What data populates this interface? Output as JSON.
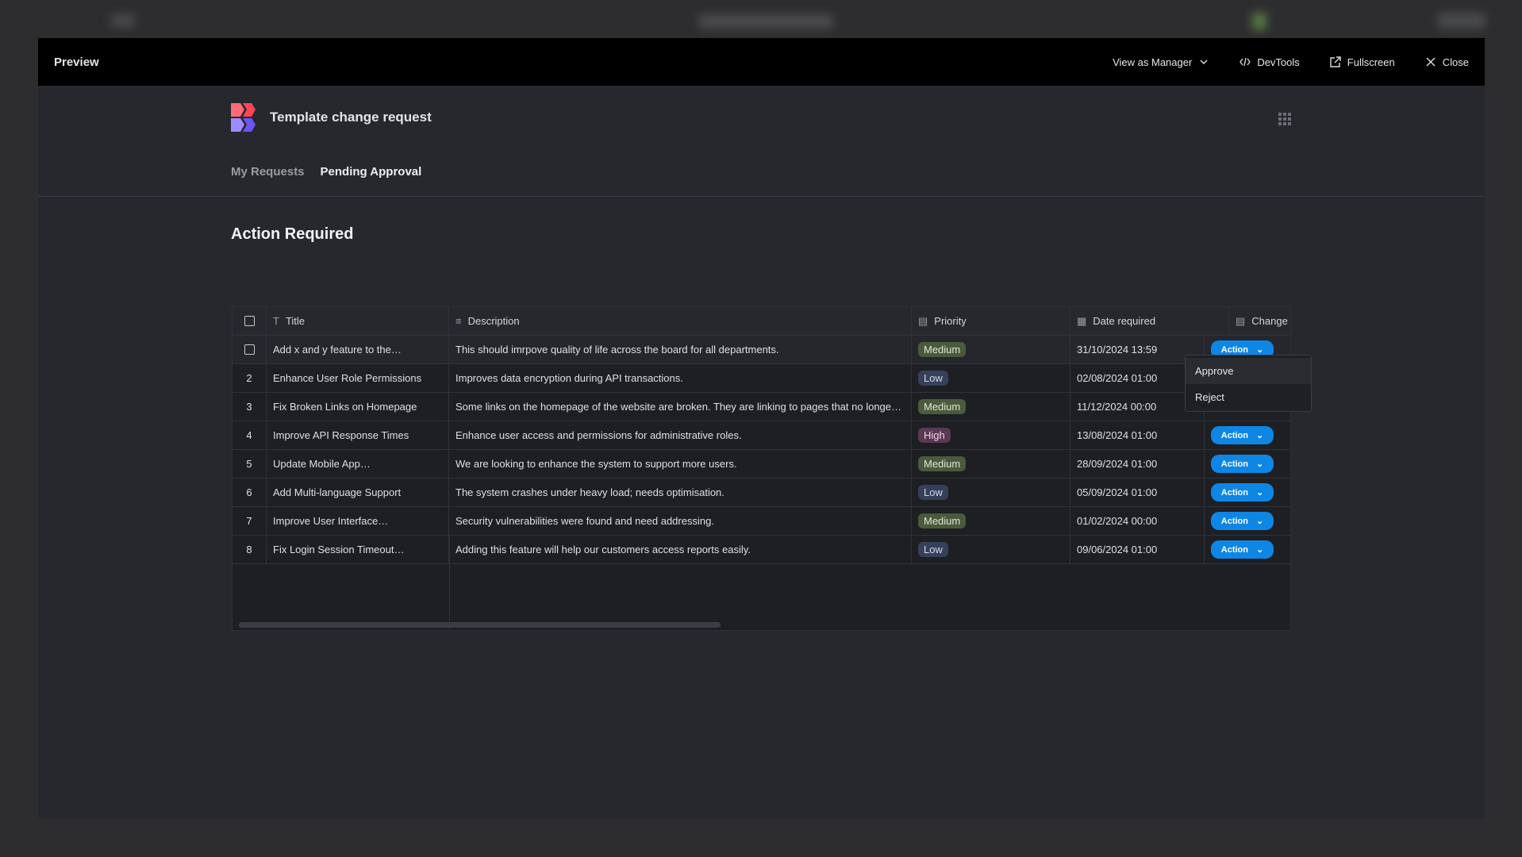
{
  "modal": {
    "title": "Preview",
    "view_as": "View as Manager",
    "devtools": "DevTools",
    "fullscreen": "Fullscreen",
    "close": "Close"
  },
  "app": {
    "title": "Template change request",
    "tabs": [
      {
        "label": "My Requests",
        "active": false
      },
      {
        "label": "Pending Approval",
        "active": true
      }
    ],
    "section_title": "Action Required"
  },
  "table": {
    "columns": {
      "title": "Title",
      "description": "Description",
      "priority": "Priority",
      "date": "Date required",
      "change": "Change"
    },
    "rows": [
      {
        "num": "",
        "title": "Add x and y feature to the…",
        "description": "This should imrpove quality of life across the board for all departments.",
        "priority": "Medium",
        "date": "31/10/2024 13:59",
        "action": "Action"
      },
      {
        "num": "2",
        "title": "Enhance User Role Permissions",
        "description": "Improves data encryption during API transactions.",
        "priority": "Low",
        "date": "02/08/2024 01:00",
        "action": "Action"
      },
      {
        "num": "3",
        "title": "Fix Broken Links on Homepage",
        "description": "Some links on the homepage of the website are broken. They are linking to pages that no longe…",
        "priority": "Medium",
        "date": "11/12/2024 00:00",
        "action": "Action"
      },
      {
        "num": "4",
        "title": "Improve API Response Times",
        "description": "Enhance user access and permissions for administrative roles.",
        "priority": "High",
        "date": "13/08/2024 01:00",
        "action": "Action"
      },
      {
        "num": "5",
        "title": "Update Mobile App…",
        "description": "We are looking to enhance the system to support more users.",
        "priority": "Medium",
        "date": "28/09/2024 01:00",
        "action": "Action"
      },
      {
        "num": "6",
        "title": "Add Multi-language Support",
        "description": "The system crashes under heavy load; needs optimisation.",
        "priority": "Low",
        "date": "05/09/2024 01:00",
        "action": "Action"
      },
      {
        "num": "7",
        "title": "Improve User Interface…",
        "description": "Security vulnerabilities were found and need addressing.",
        "priority": "Medium",
        "date": "01/02/2024 00:00",
        "action": "Action"
      },
      {
        "num": "8",
        "title": "Fix Login Session Timeout…",
        "description": "Adding this feature will help our customers access reports easily.",
        "priority": "Low",
        "date": "09/06/2024 01:00",
        "action": "Action"
      }
    ]
  },
  "dropdown": {
    "items": [
      "Approve",
      "Reject"
    ]
  },
  "colors": {
    "accent": "#0e86e6",
    "medium": "#4b5a3d",
    "low": "#35415a",
    "high": "#5b3854"
  }
}
